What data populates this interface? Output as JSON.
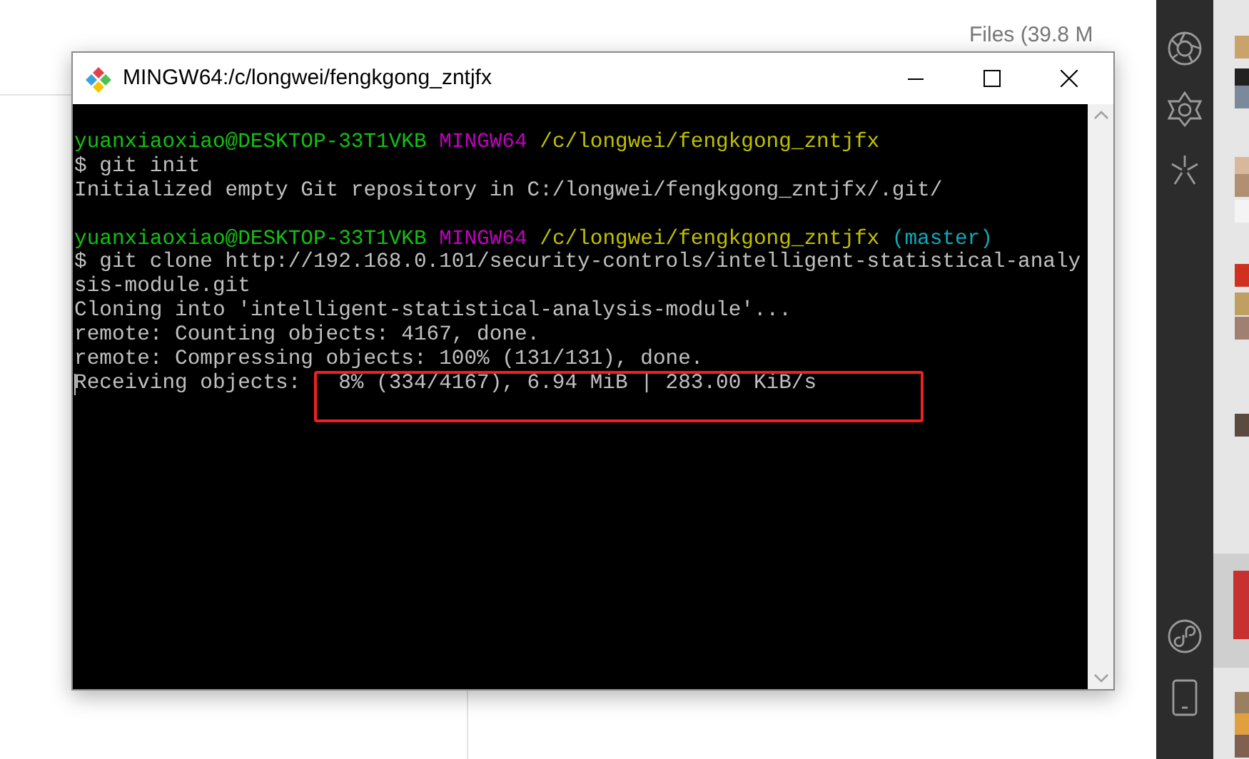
{
  "background_page": {
    "header_text": "Files (39.8 M"
  },
  "terminal_window": {
    "title": "MINGW64:/c/longwei/fengkgong_zntjfx",
    "lines": [
      {
        "kind": "text",
        "segments": [
          {
            "text": "yuanxiaoxiao@DESKTOP-33T1VKB",
            "color": "#13c013"
          },
          {
            "text": "MINGW64",
            "color": "#c000c0"
          },
          {
            "text": "/c/longwei/fengkgong_zntjfx",
            "color": "#c0c000"
          }
        ]
      },
      {
        "kind": "text",
        "segments": [
          {
            "text": "$ git init",
            "color": "#c0c0c0"
          }
        ]
      },
      {
        "kind": "text",
        "segments": [
          {
            "text": "Initialized empty Git repository in C:/longwei/fengkgong_zntjfx/.git/",
            "color": "#c0c0c0"
          }
        ]
      },
      {
        "kind": "blank"
      },
      {
        "kind": "text",
        "segments": [
          {
            "text": "yuanxiaoxiao@DESKTOP-33T1VKB",
            "color": "#13c013"
          },
          {
            "text": "MINGW64",
            "color": "#c000c0"
          },
          {
            "text": "/c/longwei/fengkgong_zntjfx",
            "color": "#c0c000"
          },
          {
            "text": "(master)",
            "color": "#11a8b8"
          }
        ]
      },
      {
        "kind": "text",
        "segments": [
          {
            "text": "$ git clone http://192.168.0.101/security-controls/intelligent-statistical-analy",
            "color": "#c0c0c0"
          }
        ]
      },
      {
        "kind": "text",
        "segments": [
          {
            "text": "sis-module.git",
            "color": "#c0c0c0"
          }
        ]
      },
      {
        "kind": "text",
        "segments": [
          {
            "text": "Cloning into 'intelligent-statistical-analysis-module'...",
            "color": "#c0c0c0"
          }
        ]
      },
      {
        "kind": "text",
        "segments": [
          {
            "text": "remote: Counting objects: 4167, done.",
            "color": "#c0c0c0"
          }
        ]
      },
      {
        "kind": "text",
        "segments": [
          {
            "text": "remote: Compressing objects: 100% (131/131), done.",
            "color": "#c0c0c0"
          }
        ]
      },
      {
        "kind": "text",
        "cursor": true,
        "segments": [
          {
            "text": "Receiving objects:   8% (334/4167), 6.94 MiB | 283.00 KiB/s",
            "color": "#c0c0c0"
          }
        ]
      }
    ]
  }
}
